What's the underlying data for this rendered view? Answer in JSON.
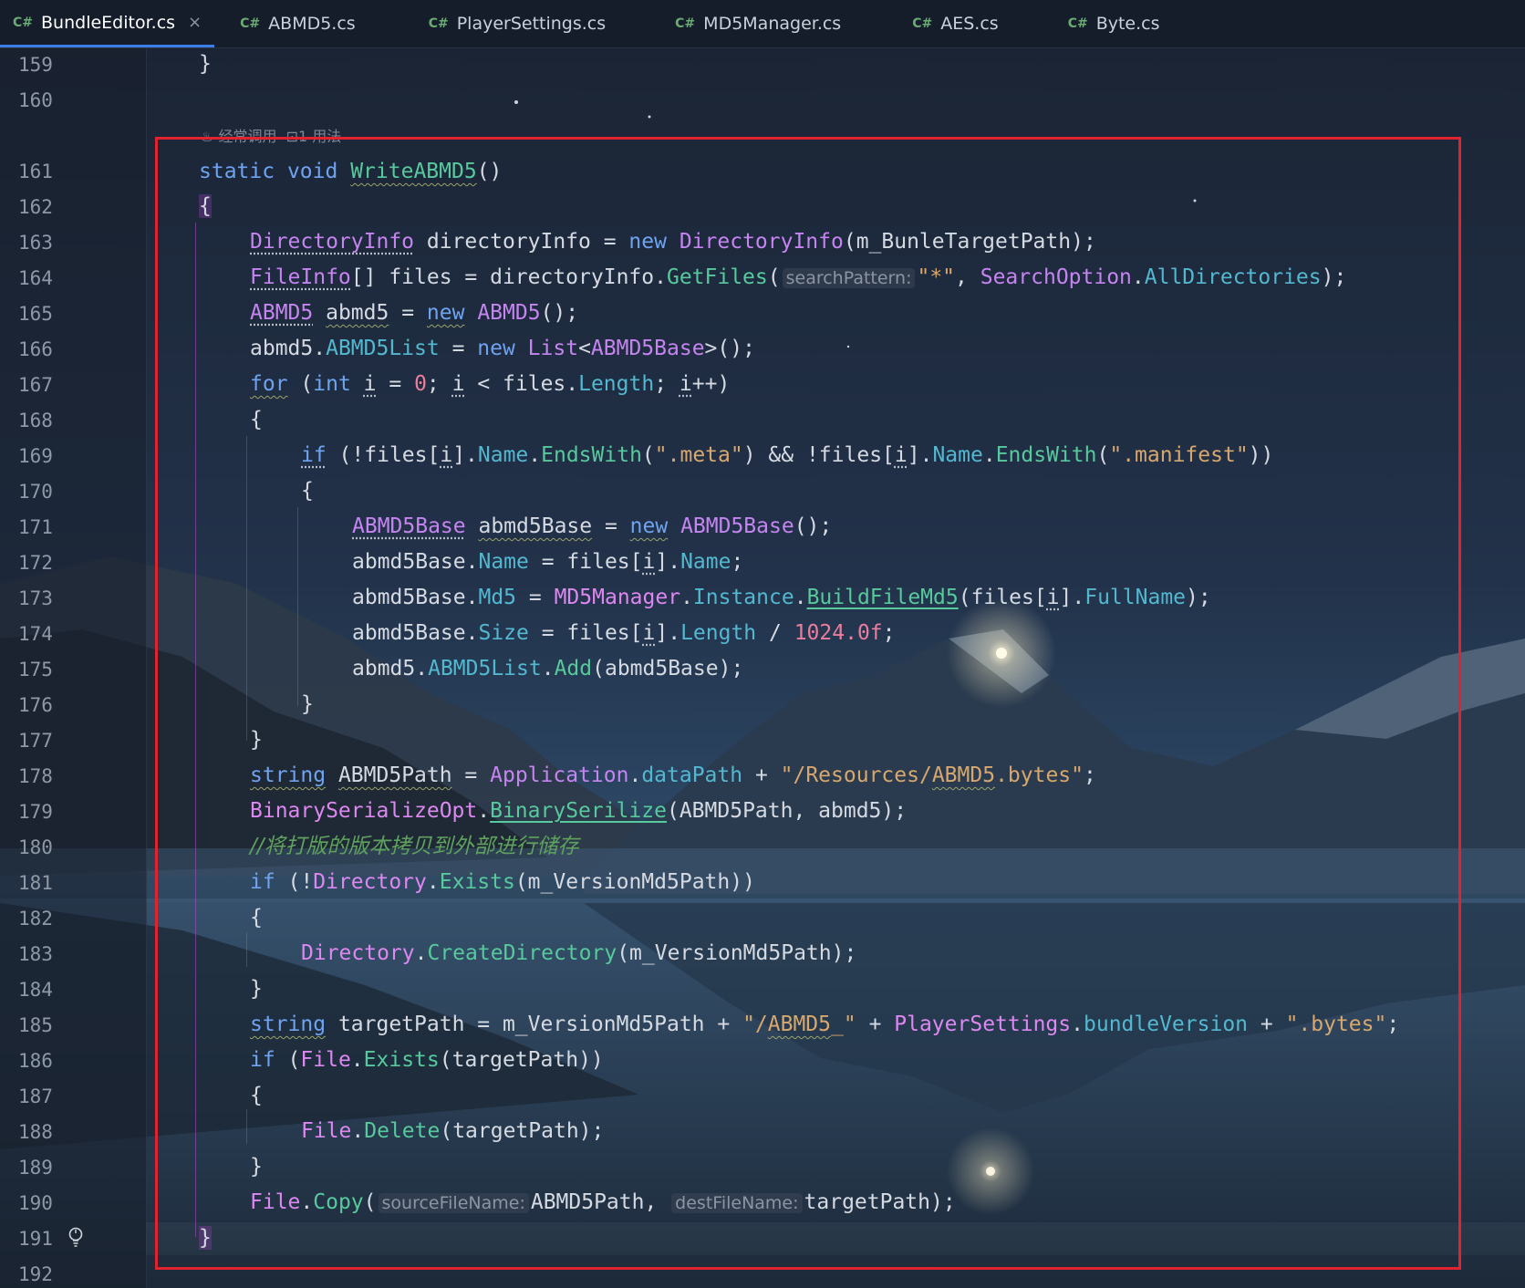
{
  "tabs": [
    {
      "lang": "C#",
      "label": "BundleEditor.cs",
      "active": true,
      "close": "×"
    },
    {
      "lang": "C#",
      "label": "ABMD5.cs"
    },
    {
      "lang": "C#",
      "label": "PlayerSettings.cs"
    },
    {
      "lang": "C#",
      "label": "MD5Manager.cs"
    },
    {
      "lang": "C#",
      "label": "AES.cs"
    },
    {
      "lang": "C#",
      "label": "Byte.cs"
    }
  ],
  "gutter": {
    "line_numbers": [
      "159",
      "160",
      "161",
      "162",
      "163",
      "164",
      "165",
      "166",
      "167",
      "168",
      "169",
      "170",
      "171",
      "172",
      "173",
      "174",
      "175",
      "176",
      "177",
      "178",
      "179",
      "180",
      "181",
      "182",
      "183",
      "184",
      "185",
      "186",
      "187",
      "188",
      "189",
      "190",
      "191",
      "192"
    ],
    "bulb_icon": "lightbulb-icon"
  },
  "code_vision": {
    "usage_hint": "经常调用",
    "refs_hint": "1 用法",
    "usage_icon": "flame-icon",
    "refs_icon": "reference-icon"
  },
  "code": {
    "l159": "}",
    "l161": {
      "kw1": "static",
      "kw2": "void",
      "name": "WriteABMD5",
      "rest": "()"
    },
    "l162": "{",
    "l163": {
      "t1": "DirectoryInfo",
      "v": " directoryInfo = ",
      "kw": "new",
      "t2": "DirectoryInfo",
      "rest": "(m_BunleTargetPath);"
    },
    "l164": {
      "t1": "FileInfo",
      "a": "[] files = directoryInfo.",
      "fn": "GetFiles",
      "p1": "(",
      "hint": "searchPattern:",
      "s": "\"*\"",
      "c": ", ",
      "t2": "SearchOption",
      "d": ".",
      "prop": "AllDirectories",
      "e": ");"
    },
    "l165": {
      "t1": "ABMD5",
      "v": "abmd5",
      "eq": " = ",
      "kw": "new",
      "t2": "ABMD5",
      "rest": "();"
    },
    "l166": {
      "a": "abmd5.",
      "prop": "ABMD5List",
      "eq": " = ",
      "kw": "new",
      "t1": "List",
      "lt": "<",
      "t2": "ABMD5Base",
      "rest": ">();"
    },
    "l167": {
      "kw": "for",
      "p": " (",
      "kw2": "int",
      "i1": "i",
      "eq": " = ",
      "n": "0",
      "sc": "; ",
      "i2": "i",
      "lt": " < files.",
      "prop": "Length",
      "sc2": "; ",
      "i3": "i",
      "rest": "++)"
    },
    "l168": "{",
    "l169": {
      "kw": "if",
      "a": " (!files[",
      "i1": "i",
      "b": "].",
      "p1": "Name",
      "d1": ".",
      "fn1": "EndsWith",
      "s1o": "(",
      "s1": "\".meta\"",
      "mid": ") && !files[",
      "i2": "i",
      "c": "].",
      "p2": "Name",
      "d2": ".",
      "fn2": "EndsWith",
      "s2o": "(",
      "s2": "\".manifest\"",
      "rest": "))"
    },
    "l170": "{",
    "l171": {
      "t1": "ABMD5Base",
      "v": "abmd5Base",
      "eq": " = ",
      "kw": "new",
      "t2": "ABMD5Base",
      "rest": "();"
    },
    "l172": {
      "a": "abmd5Base.",
      "p1": "Name",
      "b": " = files[",
      "i": "i",
      "c": "].",
      "p2": "Name",
      "rest": ";"
    },
    "l173": {
      "a": "abmd5Base.",
      "p1": "Md5",
      "b": " = ",
      "t": "MD5Manager",
      "d": ".",
      "p2": "Instance",
      "d2": ".",
      "fn": "BuildFileMd5",
      "c": "(files[",
      "i": "i",
      "e": "].",
      "p3": "FullName",
      "rest": ");"
    },
    "l174": {
      "a": "abmd5Base.",
      "p1": "Size",
      "b": " = files[",
      "i": "i",
      "c": "].",
      "p2": "Length",
      "d": " / ",
      "n": "1024.0f",
      "rest": ";"
    },
    "l175": {
      "a": "abmd5.",
      "p1": "ABMD5List",
      "d": ".",
      "fn": "Add",
      "rest": "(abmd5Base);"
    },
    "l176": "}",
    "l177": "}",
    "l178": {
      "kw": "string",
      "v": "ABMD5Path",
      "eq": " = ",
      "t": "Application",
      "d": ".",
      "p": "dataPath",
      "plus": " + ",
      "s1": "\"/Resources/",
      "s2": "ABMD5",
      "s3": ".bytes\"",
      "rest": ";"
    },
    "l179": {
      "t": "BinarySerializeOpt",
      "d": ".",
      "fn": "BinarySerilize",
      "rest": "(ABMD5Path, abmd5);"
    },
    "l180": "//将打版的版本拷贝到外部进行储存",
    "l181": {
      "kw": "if",
      "a": " (!",
      "t": "Directory",
      "d": ".",
      "fn": "Exists",
      "rest": "(m_VersionMd5Path))"
    },
    "l182": "{",
    "l183": {
      "t": "Directory",
      "d": ".",
      "fn": "CreateDirectory",
      "rest": "(m_VersionMd5Path);"
    },
    "l184": "}",
    "l185": {
      "kw": "string",
      "a": " targetPath = m_VersionMd5Path + ",
      "s1": "\"/",
      "s2": "ABMD5",
      "s3": "_\"",
      "b": " + ",
      "t": "PlayerSettings",
      "d": ".",
      "p": "bundleVersion",
      "c": " + ",
      "s4": "\".bytes\"",
      "rest": ";"
    },
    "l186": {
      "kw": "if",
      "a": " (",
      "t": "File",
      "d": ".",
      "fn": "Exists",
      "rest": "(targetPath))"
    },
    "l187": "{",
    "l188": {
      "t": "File",
      "d": ".",
      "fn": "Delete",
      "rest": "(targetPath);"
    },
    "l189": "}",
    "l190": {
      "t": "File",
      "d": ".",
      "fn": "Copy",
      "p": "(",
      "h1": "sourceFileName:",
      "a": "ABMD5Path, ",
      "h2": "destFileName:",
      "rest": "targetPath);"
    },
    "l191": "}"
  },
  "colors": {
    "accent_tab_underline": "#3d7ee6",
    "highlight_box": "#e0232e",
    "keyword": "#6fa3ef",
    "type": "#c584f0",
    "method": "#57c99c",
    "property": "#53b8cf",
    "string": "#d7a76d",
    "number": "#ea7e9e",
    "comment": "#5fa25f"
  }
}
